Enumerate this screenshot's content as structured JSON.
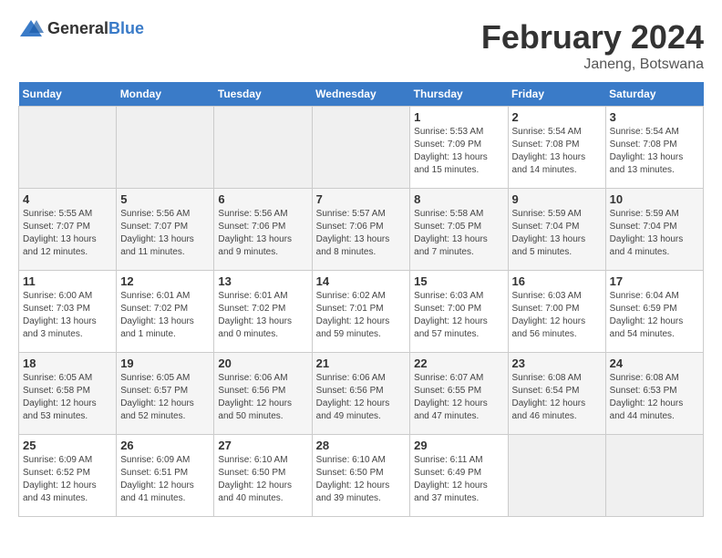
{
  "header": {
    "logo": {
      "text_general": "General",
      "text_blue": "Blue"
    },
    "title": "February 2024",
    "subtitle": "Janeng, Botswana"
  },
  "calendar": {
    "weekdays": [
      "Sunday",
      "Monday",
      "Tuesday",
      "Wednesday",
      "Thursday",
      "Friday",
      "Saturday"
    ],
    "weeks": [
      [
        {
          "day": "",
          "info": ""
        },
        {
          "day": "",
          "info": ""
        },
        {
          "day": "",
          "info": ""
        },
        {
          "day": "",
          "info": ""
        },
        {
          "day": "1",
          "info": "Sunrise: 5:53 AM\nSunset: 7:09 PM\nDaylight: 13 hours and 15 minutes."
        },
        {
          "day": "2",
          "info": "Sunrise: 5:54 AM\nSunset: 7:08 PM\nDaylight: 13 hours and 14 minutes."
        },
        {
          "day": "3",
          "info": "Sunrise: 5:54 AM\nSunset: 7:08 PM\nDaylight: 13 hours and 13 minutes."
        }
      ],
      [
        {
          "day": "4",
          "info": "Sunrise: 5:55 AM\nSunset: 7:07 PM\nDaylight: 13 hours and 12 minutes."
        },
        {
          "day": "5",
          "info": "Sunrise: 5:56 AM\nSunset: 7:07 PM\nDaylight: 13 hours and 11 minutes."
        },
        {
          "day": "6",
          "info": "Sunrise: 5:56 AM\nSunset: 7:06 PM\nDaylight: 13 hours and 9 minutes."
        },
        {
          "day": "7",
          "info": "Sunrise: 5:57 AM\nSunset: 7:06 PM\nDaylight: 13 hours and 8 minutes."
        },
        {
          "day": "8",
          "info": "Sunrise: 5:58 AM\nSunset: 7:05 PM\nDaylight: 13 hours and 7 minutes."
        },
        {
          "day": "9",
          "info": "Sunrise: 5:59 AM\nSunset: 7:04 PM\nDaylight: 13 hours and 5 minutes."
        },
        {
          "day": "10",
          "info": "Sunrise: 5:59 AM\nSunset: 7:04 PM\nDaylight: 13 hours and 4 minutes."
        }
      ],
      [
        {
          "day": "11",
          "info": "Sunrise: 6:00 AM\nSunset: 7:03 PM\nDaylight: 13 hours and 3 minutes."
        },
        {
          "day": "12",
          "info": "Sunrise: 6:01 AM\nSunset: 7:02 PM\nDaylight: 13 hours and 1 minute."
        },
        {
          "day": "13",
          "info": "Sunrise: 6:01 AM\nSunset: 7:02 PM\nDaylight: 13 hours and 0 minutes."
        },
        {
          "day": "14",
          "info": "Sunrise: 6:02 AM\nSunset: 7:01 PM\nDaylight: 12 hours and 59 minutes."
        },
        {
          "day": "15",
          "info": "Sunrise: 6:03 AM\nSunset: 7:00 PM\nDaylight: 12 hours and 57 minutes."
        },
        {
          "day": "16",
          "info": "Sunrise: 6:03 AM\nSunset: 7:00 PM\nDaylight: 12 hours and 56 minutes."
        },
        {
          "day": "17",
          "info": "Sunrise: 6:04 AM\nSunset: 6:59 PM\nDaylight: 12 hours and 54 minutes."
        }
      ],
      [
        {
          "day": "18",
          "info": "Sunrise: 6:05 AM\nSunset: 6:58 PM\nDaylight: 12 hours and 53 minutes."
        },
        {
          "day": "19",
          "info": "Sunrise: 6:05 AM\nSunset: 6:57 PM\nDaylight: 12 hours and 52 minutes."
        },
        {
          "day": "20",
          "info": "Sunrise: 6:06 AM\nSunset: 6:56 PM\nDaylight: 12 hours and 50 minutes."
        },
        {
          "day": "21",
          "info": "Sunrise: 6:06 AM\nSunset: 6:56 PM\nDaylight: 12 hours and 49 minutes."
        },
        {
          "day": "22",
          "info": "Sunrise: 6:07 AM\nSunset: 6:55 PM\nDaylight: 12 hours and 47 minutes."
        },
        {
          "day": "23",
          "info": "Sunrise: 6:08 AM\nSunset: 6:54 PM\nDaylight: 12 hours and 46 minutes."
        },
        {
          "day": "24",
          "info": "Sunrise: 6:08 AM\nSunset: 6:53 PM\nDaylight: 12 hours and 44 minutes."
        }
      ],
      [
        {
          "day": "25",
          "info": "Sunrise: 6:09 AM\nSunset: 6:52 PM\nDaylight: 12 hours and 43 minutes."
        },
        {
          "day": "26",
          "info": "Sunrise: 6:09 AM\nSunset: 6:51 PM\nDaylight: 12 hours and 41 minutes."
        },
        {
          "day": "27",
          "info": "Sunrise: 6:10 AM\nSunset: 6:50 PM\nDaylight: 12 hours and 40 minutes."
        },
        {
          "day": "28",
          "info": "Sunrise: 6:10 AM\nSunset: 6:50 PM\nDaylight: 12 hours and 39 minutes."
        },
        {
          "day": "29",
          "info": "Sunrise: 6:11 AM\nSunset: 6:49 PM\nDaylight: 12 hours and 37 minutes."
        },
        {
          "day": "",
          "info": ""
        },
        {
          "day": "",
          "info": ""
        }
      ]
    ]
  }
}
